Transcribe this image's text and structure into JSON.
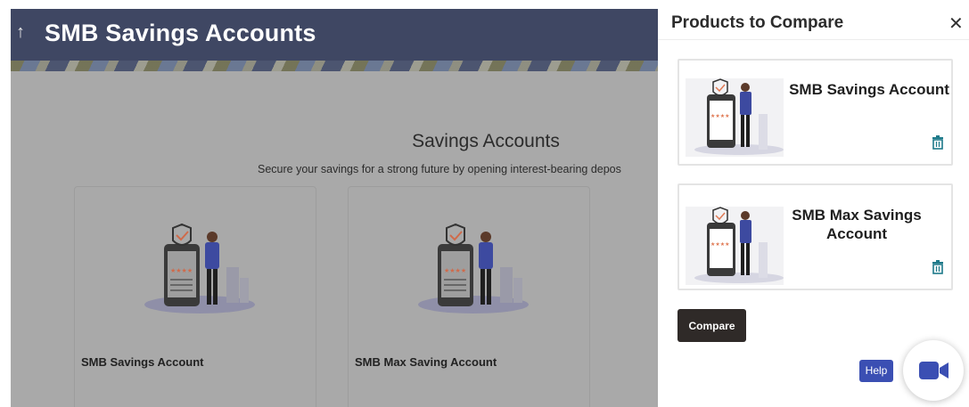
{
  "header": {
    "back_icon": "arrow-up-icon",
    "title": "SMB Savings Accounts"
  },
  "section": {
    "title": "Savings Accounts",
    "subtitle": "Secure your savings for a strong future by opening interest-bearing depos"
  },
  "cards": [
    {
      "name": "SMB Savings Account"
    },
    {
      "name": "SMB Max Saving Account"
    }
  ],
  "panel": {
    "title": "Products to Compare",
    "close_icon": "close-icon",
    "items": [
      {
        "name": "SMB Savings Account"
      },
      {
        "name": "SMB Max Savings Account"
      }
    ],
    "compare_label": "Compare"
  },
  "help_label": "Help",
  "colors": {
    "header": "#3f4763",
    "help": "#3b4fb3",
    "compare_button": "#2f2a28",
    "trash": "#1e7a8a",
    "video_icon": "#3b4fb3"
  }
}
